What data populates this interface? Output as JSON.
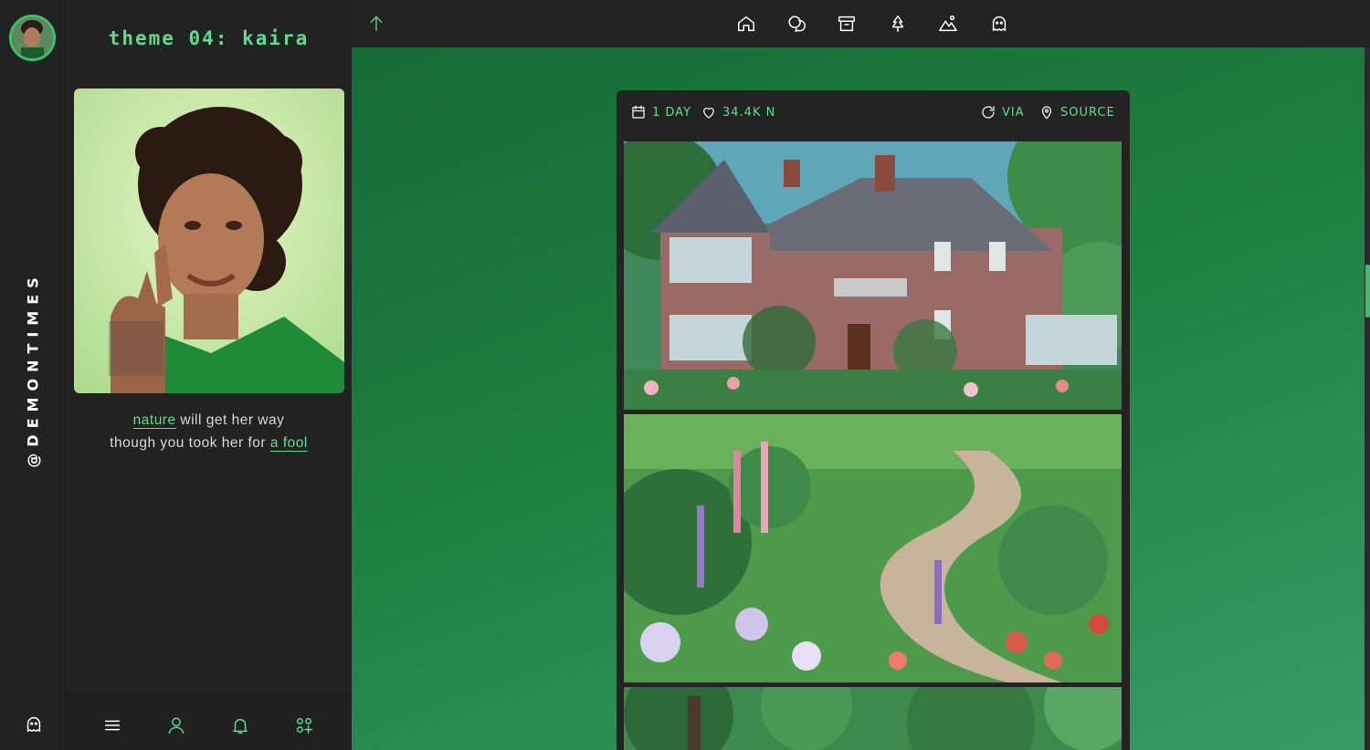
{
  "rail": {
    "vertical_handle": "@DEMONTIMES",
    "bottom_icon": "ghost-icon"
  },
  "sidebar": {
    "title": "theme 04: kaira",
    "caption": {
      "line1_link": "nature",
      "line1_rest": " will get her way",
      "line2_text": "though you took her for ",
      "line2_link": "a fool"
    },
    "bottom_icons": [
      "menu-icon",
      "user-icon",
      "bell-icon",
      "apps-icon"
    ]
  },
  "topbar": {
    "back_icon": "arrow-up-icon",
    "nav_icons": [
      "home-icon",
      "chat-icon",
      "archive-icon",
      "tree-icon",
      "mountain-icon",
      "ghost-icon"
    ]
  },
  "post": {
    "date": "1 DAY",
    "notes": "34.4K N",
    "via": "VIA",
    "source": "SOURCE",
    "images": [
      "house-garden-painting",
      "flower-garden-path-painting",
      "forest-trees-painting"
    ]
  },
  "colors": {
    "accent": "#5fdc8c",
    "panel": "#222222",
    "main_green": "#1f7f40"
  }
}
